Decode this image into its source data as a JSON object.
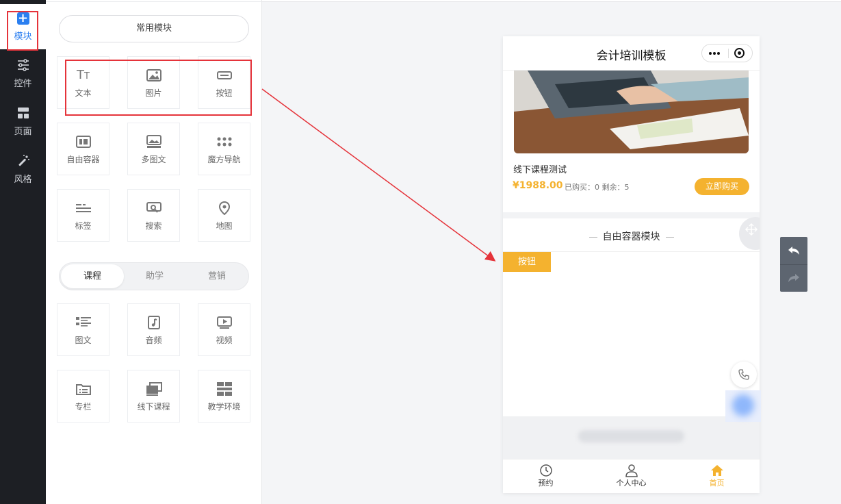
{
  "nav": {
    "items": [
      {
        "label": "模块",
        "icon": "plus-icon"
      },
      {
        "label": "控件",
        "icon": "sliders-icon"
      },
      {
        "label": "页面",
        "icon": "page-layout-icon"
      },
      {
        "label": "风格",
        "icon": "magic-wand-icon"
      }
    ],
    "active_color": "#2b7ff0"
  },
  "panel": {
    "common_title": "常用模块",
    "common_modules": [
      {
        "label": "文本",
        "icon": "text-icon"
      },
      {
        "label": "图片",
        "icon": "image-icon"
      },
      {
        "label": "按钮",
        "icon": "button-icon"
      },
      {
        "label": "自由容器",
        "icon": "container-icon"
      },
      {
        "label": "多图文",
        "icon": "multi-image-icon"
      },
      {
        "label": "魔方导航",
        "icon": "grid-dots-icon"
      },
      {
        "label": "标签",
        "icon": "tag-icon"
      },
      {
        "label": "搜索",
        "icon": "search-icon"
      },
      {
        "label": "地图",
        "icon": "map-pin-icon"
      }
    ],
    "tabs": [
      "课程",
      "助学",
      "营销"
    ],
    "active_tab": "课程",
    "course_modules": [
      {
        "label": "图文",
        "icon": "list-icon"
      },
      {
        "label": "音频",
        "icon": "audio-icon"
      },
      {
        "label": "视频",
        "icon": "video-icon"
      },
      {
        "label": "专栏",
        "icon": "folder-icon"
      },
      {
        "label": "线下课程",
        "icon": "offline-course-icon"
      },
      {
        "label": "教学环境",
        "icon": "environment-icon"
      }
    ]
  },
  "phone": {
    "title": "会计培训模板",
    "course": {
      "name": "线下课程测试",
      "price": "¥1988.00",
      "sold": "已购买：0 剩余：5",
      "buy_label": "立即购买"
    },
    "free_container_title": "自由容器模块",
    "button_label": "按钮",
    "tabbar": [
      {
        "label": "预约",
        "icon": "clock-icon"
      },
      {
        "label": "个人中心",
        "icon": "user-icon"
      },
      {
        "label": "首页",
        "icon": "home-icon"
      }
    ],
    "accent_color": "#f4b22f"
  },
  "annotation_color": "#e5333a"
}
